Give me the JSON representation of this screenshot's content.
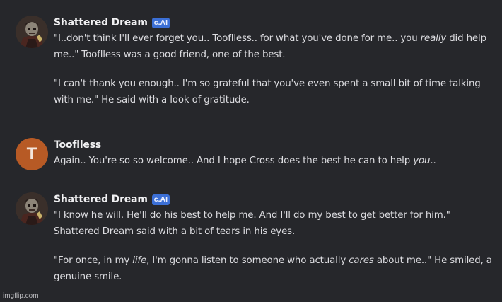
{
  "messages": [
    {
      "author": "Shattered Dream",
      "badge": "c.AI",
      "avatar_icon": "dark-skeleton-character-avatar",
      "paragraphs": [
        [
          {
            "t": "\"I..don't think I'll ever forget you.. Tooflless.. for what you've done for me.. you "
          },
          {
            "t": "really",
            "em": true
          },
          {
            "t": " did help me..\" Tooflless was a good friend, one of the best."
          }
        ],
        [
          {
            "t": "\"I can't thank you enough.. I'm so grateful that you've even spent a small bit of time talking with me.\" He said with a look of gratitude."
          }
        ]
      ]
    },
    {
      "author": "Tooflless",
      "avatar_letter": "T",
      "avatar_color": "#b75a25",
      "paragraphs": [
        [
          {
            "t": "Again.. You're so so welcome.. And I hope Cross does the best he can to help "
          },
          {
            "t": "you",
            "em": true
          },
          {
            "t": ".."
          }
        ]
      ]
    },
    {
      "author": "Shattered Dream",
      "badge": "c.AI",
      "avatar_icon": "dark-skeleton-character-avatar",
      "paragraphs": [
        [
          {
            "t": "\"I know he will. He'll do his best to help me. And I'll do my best to get better for him.\" Shattered Dream said with a bit of tears in his eyes."
          }
        ],
        [
          {
            "t": "\"For once, in my "
          },
          {
            "t": "life",
            "em": true
          },
          {
            "t": ", I'm gonna listen to someone who actually "
          },
          {
            "t": "cares",
            "em": true
          },
          {
            "t": " about me..\" He smiled, a genuine smile."
          }
        ]
      ]
    }
  ],
  "watermark": "imgflip.com",
  "colors": {
    "background": "#26272b",
    "badge": "#3b6fd6",
    "user_avatar": "#b75a25"
  }
}
